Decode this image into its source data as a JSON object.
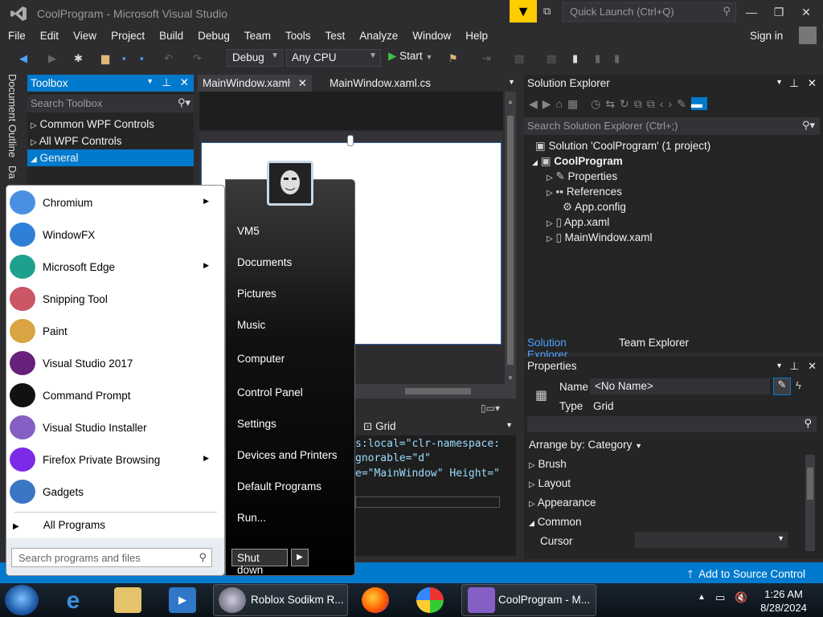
{
  "window": {
    "title": "CoolProgram - Microsoft Visual Studio",
    "quick_launch_placeholder": "Quick Launch (Ctrl+Q)",
    "sign_in": "Sign in"
  },
  "menu": [
    "File",
    "Edit",
    "View",
    "Project",
    "Build",
    "Debug",
    "Team",
    "Tools",
    "Test",
    "Analyze",
    "Window",
    "Help"
  ],
  "toolbar": {
    "config": "Debug",
    "platform": "Any CPU",
    "start": "Start"
  },
  "side_tabs": {
    "doc_outline": "Document Outline",
    "data": "Da"
  },
  "toolbox": {
    "title": "Toolbox",
    "search_placeholder": "Search Toolbox",
    "items": [
      {
        "label": "Common WPF Controls",
        "selected": false
      },
      {
        "label": "All WPF Controls",
        "selected": false
      },
      {
        "label": "General",
        "selected": true
      }
    ]
  },
  "editor": {
    "tabs": [
      "MainWindow.xaml",
      "MainWindow.xaml.cs"
    ],
    "grid_label": "Grid",
    "code_lines": [
      "s:local=\"clr-namespace:",
      "gnorable=\"d\"",
      "e=\"MainWindow\" Height=\""
    ]
  },
  "solution_explorer": {
    "title": "Solution Explorer",
    "search_placeholder": "Search Solution Explorer (Ctrl+;)",
    "solution": "Solution 'CoolProgram' (1 project)",
    "project": "CoolProgram",
    "items": [
      "Properties",
      "References",
      "App.config",
      "App.xaml",
      "MainWindow.xaml"
    ],
    "tabs": [
      "Solution Explorer",
      "Team Explorer"
    ]
  },
  "properties": {
    "title": "Properties",
    "name_label": "Name",
    "name_value": "<No Name>",
    "type_label": "Type",
    "type_value": "Grid",
    "arrange_by": "Arrange by: Category",
    "categories": [
      "Brush",
      "Layout",
      "Appearance",
      "Common"
    ],
    "cursor_label": "Cursor"
  },
  "status": {
    "source_control": "Add to Source Control"
  },
  "start_menu": {
    "programs": [
      {
        "label": "Chromium",
        "icon": "chromium-icon",
        "has_submenu": true,
        "color": "#4a90e2"
      },
      {
        "label": "WindowFX",
        "icon": "windowfx-icon",
        "has_submenu": false,
        "color": "#2f7fd8"
      },
      {
        "label": "Microsoft Edge",
        "icon": "edge-icon",
        "has_submenu": true,
        "color": "#1fa08e"
      },
      {
        "label": "Snipping Tool",
        "icon": "scissors-icon",
        "has_submenu": false,
        "color": "#cc5566"
      },
      {
        "label": "Paint",
        "icon": "palette-icon",
        "has_submenu": false,
        "color": "#d9a441"
      },
      {
        "label": "Visual Studio 2017",
        "icon": "visual-studio-icon",
        "has_submenu": false,
        "color": "#68217a"
      },
      {
        "label": "Command Prompt",
        "icon": "cmd-icon",
        "has_submenu": false,
        "color": "#111111"
      },
      {
        "label": "Visual Studio Installer",
        "icon": "vs-installer-icon",
        "has_submenu": false,
        "color": "#865fc5"
      },
      {
        "label": "Firefox Private Browsing",
        "icon": "firefox-private-icon",
        "has_submenu": true,
        "color": "#7d2ae8"
      },
      {
        "label": "Gadgets",
        "icon": "gadgets-icon",
        "has_submenu": false,
        "color": "#3a76c4"
      }
    ],
    "all_programs": "All Programs",
    "search_placeholder": "Search programs and files",
    "right_items": [
      "VM5",
      "Documents",
      "Pictures",
      "Music",
      "Computer",
      "Control Panel",
      "Settings",
      "Devices and Printers",
      "Default Programs",
      "Run..."
    ],
    "shutdown": "Shut down"
  },
  "taskbar": {
    "tasks": [
      {
        "label": "Roblox Sodikm R..."
      },
      {
        "label": "CoolProgram - M..."
      }
    ],
    "time": "1:26 AM",
    "date": "8/28/2024"
  }
}
